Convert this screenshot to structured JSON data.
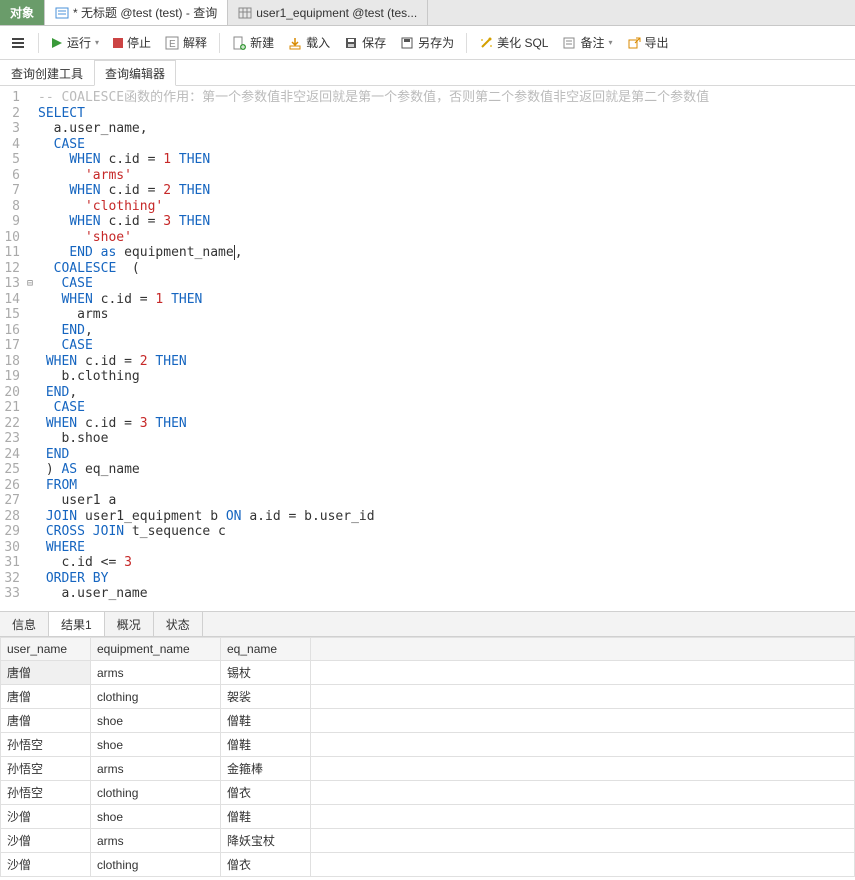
{
  "top_tabs": {
    "object": "对象",
    "query": "* 无标题 @test (test) - 查询",
    "table": "user1_equipment @test (tes..."
  },
  "toolbar": {
    "run": "运行",
    "stop": "停止",
    "explain": "解释",
    "new": "新建",
    "load": "载入",
    "save": "保存",
    "saveas": "另存为",
    "beautify": "美化 SQL",
    "notes": "备注",
    "export": "导出"
  },
  "subtabs": {
    "builder": "查询创建工具",
    "editor": "查询编辑器"
  },
  "code_lines": [
    [
      {
        "t": "-- COALESCE函数的作用：第一个参数值非空返回就是第一个参数值，否则第二个参数值非空返回就是第二个参数值",
        "c": "cm"
      }
    ],
    [
      {
        "t": "SELECT",
        "c": "kw"
      }
    ],
    [
      {
        "t": "  a.user_name,",
        "c": ""
      }
    ],
    [
      {
        "t": "  ",
        "c": ""
      },
      {
        "t": "CASE",
        "c": "kw"
      }
    ],
    [
      {
        "t": "    ",
        "c": ""
      },
      {
        "t": "WHEN",
        "c": "kw"
      },
      {
        "t": " c.id = ",
        "c": ""
      },
      {
        "t": "1",
        "c": "num"
      },
      {
        "t": " ",
        "c": ""
      },
      {
        "t": "THEN",
        "c": "kw"
      }
    ],
    [
      {
        "t": "      ",
        "c": ""
      },
      {
        "t": "'arms'",
        "c": "str"
      }
    ],
    [
      {
        "t": "    ",
        "c": ""
      },
      {
        "t": "WHEN",
        "c": "kw"
      },
      {
        "t": " c.id = ",
        "c": ""
      },
      {
        "t": "2",
        "c": "num"
      },
      {
        "t": " ",
        "c": ""
      },
      {
        "t": "THEN",
        "c": "kw"
      }
    ],
    [
      {
        "t": "      ",
        "c": ""
      },
      {
        "t": "'clothing'",
        "c": "str"
      }
    ],
    [
      {
        "t": "    ",
        "c": ""
      },
      {
        "t": "WHEN",
        "c": "kw"
      },
      {
        "t": " c.id = ",
        "c": ""
      },
      {
        "t": "3",
        "c": "num"
      },
      {
        "t": " ",
        "c": ""
      },
      {
        "t": "THEN",
        "c": "kw"
      }
    ],
    [
      {
        "t": "      ",
        "c": ""
      },
      {
        "t": "'shoe'",
        "c": "str"
      }
    ],
    [
      {
        "t": "    ",
        "c": ""
      },
      {
        "t": "END",
        "c": "kw"
      },
      {
        "t": " ",
        "c": ""
      },
      {
        "t": "as",
        "c": "kw"
      },
      {
        "t": " equipment_name",
        "c": ""
      },
      {
        "t": "",
        "c": "cursor"
      },
      {
        "t": ",",
        "c": ""
      }
    ],
    [
      {
        "t": "  ",
        "c": ""
      },
      {
        "t": "COALESCE",
        "c": "kw"
      },
      {
        "t": "  (",
        "c": ""
      }
    ],
    [
      {
        "t": "   ",
        "c": ""
      },
      {
        "t": "CASE",
        "c": "kw"
      }
    ],
    [
      {
        "t": "   ",
        "c": ""
      },
      {
        "t": "WHEN",
        "c": "kw"
      },
      {
        "t": " c.id = ",
        "c": ""
      },
      {
        "t": "1",
        "c": "num"
      },
      {
        "t": " ",
        "c": ""
      },
      {
        "t": "THEN",
        "c": "kw"
      }
    ],
    [
      {
        "t": "     arms",
        "c": ""
      }
    ],
    [
      {
        "t": "   ",
        "c": ""
      },
      {
        "t": "END",
        "c": "kw"
      },
      {
        "t": ",",
        "c": ""
      }
    ],
    [
      {
        "t": "   ",
        "c": ""
      },
      {
        "t": "CASE",
        "c": "kw"
      }
    ],
    [
      {
        "t": " ",
        "c": ""
      },
      {
        "t": "WHEN",
        "c": "kw"
      },
      {
        "t": " c.id = ",
        "c": ""
      },
      {
        "t": "2",
        "c": "num"
      },
      {
        "t": " ",
        "c": ""
      },
      {
        "t": "THEN",
        "c": "kw"
      }
    ],
    [
      {
        "t": "   b.clothing",
        "c": ""
      }
    ],
    [
      {
        "t": " ",
        "c": ""
      },
      {
        "t": "END",
        "c": "kw"
      },
      {
        "t": ",",
        "c": ""
      }
    ],
    [
      {
        "t": "  ",
        "c": ""
      },
      {
        "t": "CASE",
        "c": "kw"
      }
    ],
    [
      {
        "t": " ",
        "c": ""
      },
      {
        "t": "WHEN",
        "c": "kw"
      },
      {
        "t": " c.id = ",
        "c": ""
      },
      {
        "t": "3",
        "c": "num"
      },
      {
        "t": " ",
        "c": ""
      },
      {
        "t": "THEN",
        "c": "kw"
      }
    ],
    [
      {
        "t": "   b.shoe",
        "c": ""
      }
    ],
    [
      {
        "t": " ",
        "c": ""
      },
      {
        "t": "END",
        "c": "kw"
      }
    ],
    [
      {
        "t": " ) ",
        "c": ""
      },
      {
        "t": "AS",
        "c": "kw"
      },
      {
        "t": " eq_name",
        "c": ""
      }
    ],
    [
      {
        "t": " ",
        "c": ""
      },
      {
        "t": "FROM",
        "c": "kw"
      }
    ],
    [
      {
        "t": "   user1 a",
        "c": ""
      }
    ],
    [
      {
        "t": " ",
        "c": ""
      },
      {
        "t": "JOIN",
        "c": "kw"
      },
      {
        "t": " user1_equipment b ",
        "c": ""
      },
      {
        "t": "ON",
        "c": "kw"
      },
      {
        "t": " a.id = b.user_id",
        "c": ""
      }
    ],
    [
      {
        "t": " ",
        "c": ""
      },
      {
        "t": "CROSS JOIN",
        "c": "kw"
      },
      {
        "t": " t_sequence c",
        "c": ""
      }
    ],
    [
      {
        "t": " ",
        "c": ""
      },
      {
        "t": "WHERE",
        "c": "kw"
      }
    ],
    [
      {
        "t": "   c.id <= ",
        "c": ""
      },
      {
        "t": "3",
        "c": "num"
      }
    ],
    [
      {
        "t": " ",
        "c": ""
      },
      {
        "t": "ORDER BY",
        "c": "kw"
      }
    ],
    [
      {
        "t": "   a.user_name",
        "c": ""
      }
    ]
  ],
  "fold_marks": {
    "13": "⊟"
  },
  "result_tabs": {
    "info": "信息",
    "result1": "结果1",
    "profile": "概况",
    "status": "状态"
  },
  "grid": {
    "columns": [
      "user_name",
      "equipment_name",
      "eq_name"
    ],
    "rows": [
      [
        "唐僧",
        "arms",
        "锡杖"
      ],
      [
        "唐僧",
        "clothing",
        "袈裟"
      ],
      [
        "唐僧",
        "shoe",
        "僧鞋"
      ],
      [
        "孙悟空",
        "shoe",
        "僧鞋"
      ],
      [
        "孙悟空",
        "arms",
        "金箍棒"
      ],
      [
        "孙悟空",
        "clothing",
        "僧衣"
      ],
      [
        "沙僧",
        "shoe",
        "僧鞋"
      ],
      [
        "沙僧",
        "arms",
        "降妖宝杖"
      ],
      [
        "沙僧",
        "clothing",
        "僧衣"
      ]
    ]
  }
}
